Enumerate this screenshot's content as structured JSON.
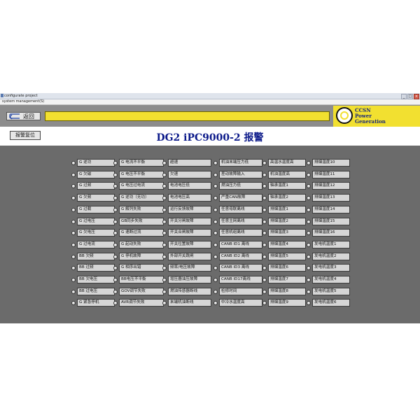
{
  "window": {
    "title": "configurate project",
    "menu": "system management(S)",
    "buttons": [
      "_",
      "□",
      "×"
    ]
  },
  "header": {
    "back_label": "返回"
  },
  "logo": {
    "line1": "CCSN",
    "line2": "Power",
    "line3": "Generation"
  },
  "toolbar": {
    "reset_label": "报警复位"
  },
  "page": {
    "title": "DG2  iPC9000-2 报警"
  },
  "alarm_columns": [
    [
      "G  逆功",
      "G  欠磁",
      "G  过频",
      "G  欠频",
      "G  过载",
      "G  过电压",
      "G  欠电压",
      "G  过电流",
      "BB 欠频",
      "BB 过频",
      "BB 欠电压",
      "BB 过电压",
      "G  紧急停机"
    ],
    [
      "G 电流不平衡",
      "G 电压不平衡",
      "G 电压过电流",
      "G 逆功（无功）",
      "G 解列失败",
      "GB同步失败",
      "G 速断过流",
      "G 起动失败",
      "G 停机故障",
      "G 相序出错",
      "BB电压不平衡",
      "GOV调节失败",
      "AVR调节失败"
    ],
    [
      "超速",
      "欠速",
      "电池电压低",
      "电池电压高",
      "运行反馈故障",
      "开关分闸故障",
      "开关合闸故障",
      "开关位置故障",
      "外部开关跳闸",
      "频率/电压故障",
      "增压器油压故障",
      "燃油传感器断线",
      "末端机油断线"
    ],
    [
      "机油末端压力低",
      "差动故障输入",
      "燃油压力低",
      "严重CAN故障",
      "任意母联离线",
      "任意主网离线",
      "任意机组离线",
      "CANB  ID1  离线",
      "CANB  ID2  离线",
      "CANB  ID3  离线",
      "CANB  ID17离线",
      "检修时间",
      "中冷水温度高"
    ],
    [
      "高温水温度高",
      "机油温度高",
      "轴承温度1",
      "轴承温度2",
      "排烟温度1",
      "排烟温度2",
      "排烟温度3",
      "排烟温度4",
      "排烟温度5",
      "排烟温度6",
      "排烟温度7",
      "排烟温度8",
      "排烟温度9"
    ],
    [
      "排烟温度10",
      "排烟温度11",
      "排烟温度12",
      "排烟温度13",
      "排烟温度14",
      "排烟温度15",
      "排烟温度16",
      "发电机温度1",
      "发电机温度2",
      "发电机温度3",
      "发电机温度4",
      "发电机温度5",
      "发电机温度6"
    ]
  ]
}
